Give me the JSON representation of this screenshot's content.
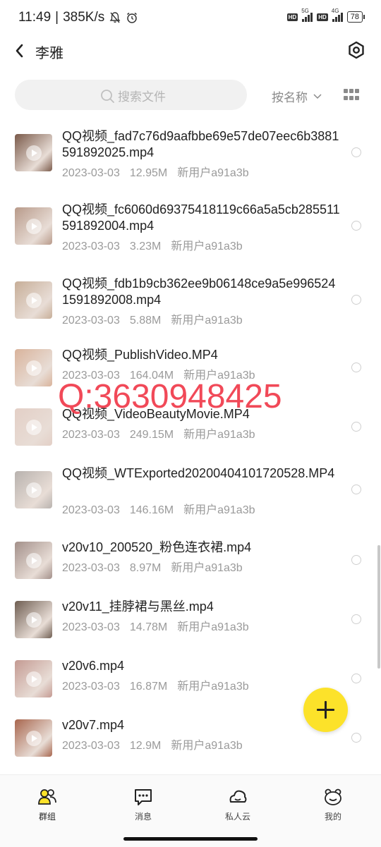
{
  "status_bar": {
    "time": "11:49",
    "speed": "385K/s",
    "sim1": "5G",
    "sim2": "4G",
    "hd": "HD",
    "battery": "78"
  },
  "header": {
    "title": "李雅"
  },
  "search": {
    "placeholder": "搜索文件"
  },
  "sort": {
    "label": "按名称"
  },
  "files": [
    {
      "name": "QQ视频_fad7c76d9aafbbe69e57de07eec6b3881591892025.mp4",
      "date": "2023-03-03",
      "size": "12.95M",
      "owner": "新用户a91a3b",
      "thumb_color": "#7a5a4a"
    },
    {
      "name": "QQ视频_fc6060d69375418119c66a5a5cb285511591892004.mp4",
      "date": "2023-03-03",
      "size": "3.23M",
      "owner": "新用户a91a3b",
      "thumb_color": "#b89a8a"
    },
    {
      "name": "QQ视频_fdb1b9cb362ee9b06148ce9a5e9965241591892008.mp4",
      "date": "2023-03-03",
      "size": "5.88M",
      "owner": "新用户a91a3b",
      "thumb_color": "#c7ae98"
    },
    {
      "name": "QQ视频_PublishVideo.MP4",
      "date": "2023-03-03",
      "size": "164.04M",
      "owner": "新用户a91a3b",
      "thumb_color": "#d9b39b"
    },
    {
      "name": "QQ视频_VideoBeautyMovie.MP4",
      "date": "2023-03-03",
      "size": "249.15M",
      "owner": "新用户a91a3b",
      "thumb_color": "#e3cfc6"
    },
    {
      "name": "QQ视频_WTExported20200404101720528.MP4",
      "date": "2023-03-03",
      "size": "146.16M",
      "owner": "新用户a91a3b",
      "thumb_color": "#b8b2ae"
    },
    {
      "name": "v20v10_200520_粉色连衣裙.mp4",
      "date": "2023-03-03",
      "size": "8.97M",
      "owner": "新用户a91a3b",
      "thumb_color": "#a3908a"
    },
    {
      "name": "v20v11_挂脖裙与黑丝.mp4",
      "date": "2023-03-03",
      "size": "14.78M",
      "owner": "新用户a91a3b",
      "thumb_color": "#6f5e52"
    },
    {
      "name": "v20v6.mp4",
      "date": "2023-03-03",
      "size": "16.87M",
      "owner": "新用户a91a3b",
      "thumb_color": "#c49a92"
    },
    {
      "name": "v20v7.mp4",
      "date": "2023-03-03",
      "size": "12.9M",
      "owner": "新用户a91a3b",
      "thumb_color": "#a8664e"
    }
  ],
  "watermark": "Q:3630948425",
  "bottom_nav": [
    {
      "label": "群组",
      "icon": "group-icon",
      "active": true
    },
    {
      "label": "消息",
      "icon": "message-icon",
      "active": false
    },
    {
      "label": "私人云",
      "icon": "cloud-icon",
      "active": false
    },
    {
      "label": "我的",
      "icon": "profile-icon",
      "active": false
    }
  ],
  "colors": {
    "accent": "#fce22a",
    "watermark": "#f03a4a"
  }
}
